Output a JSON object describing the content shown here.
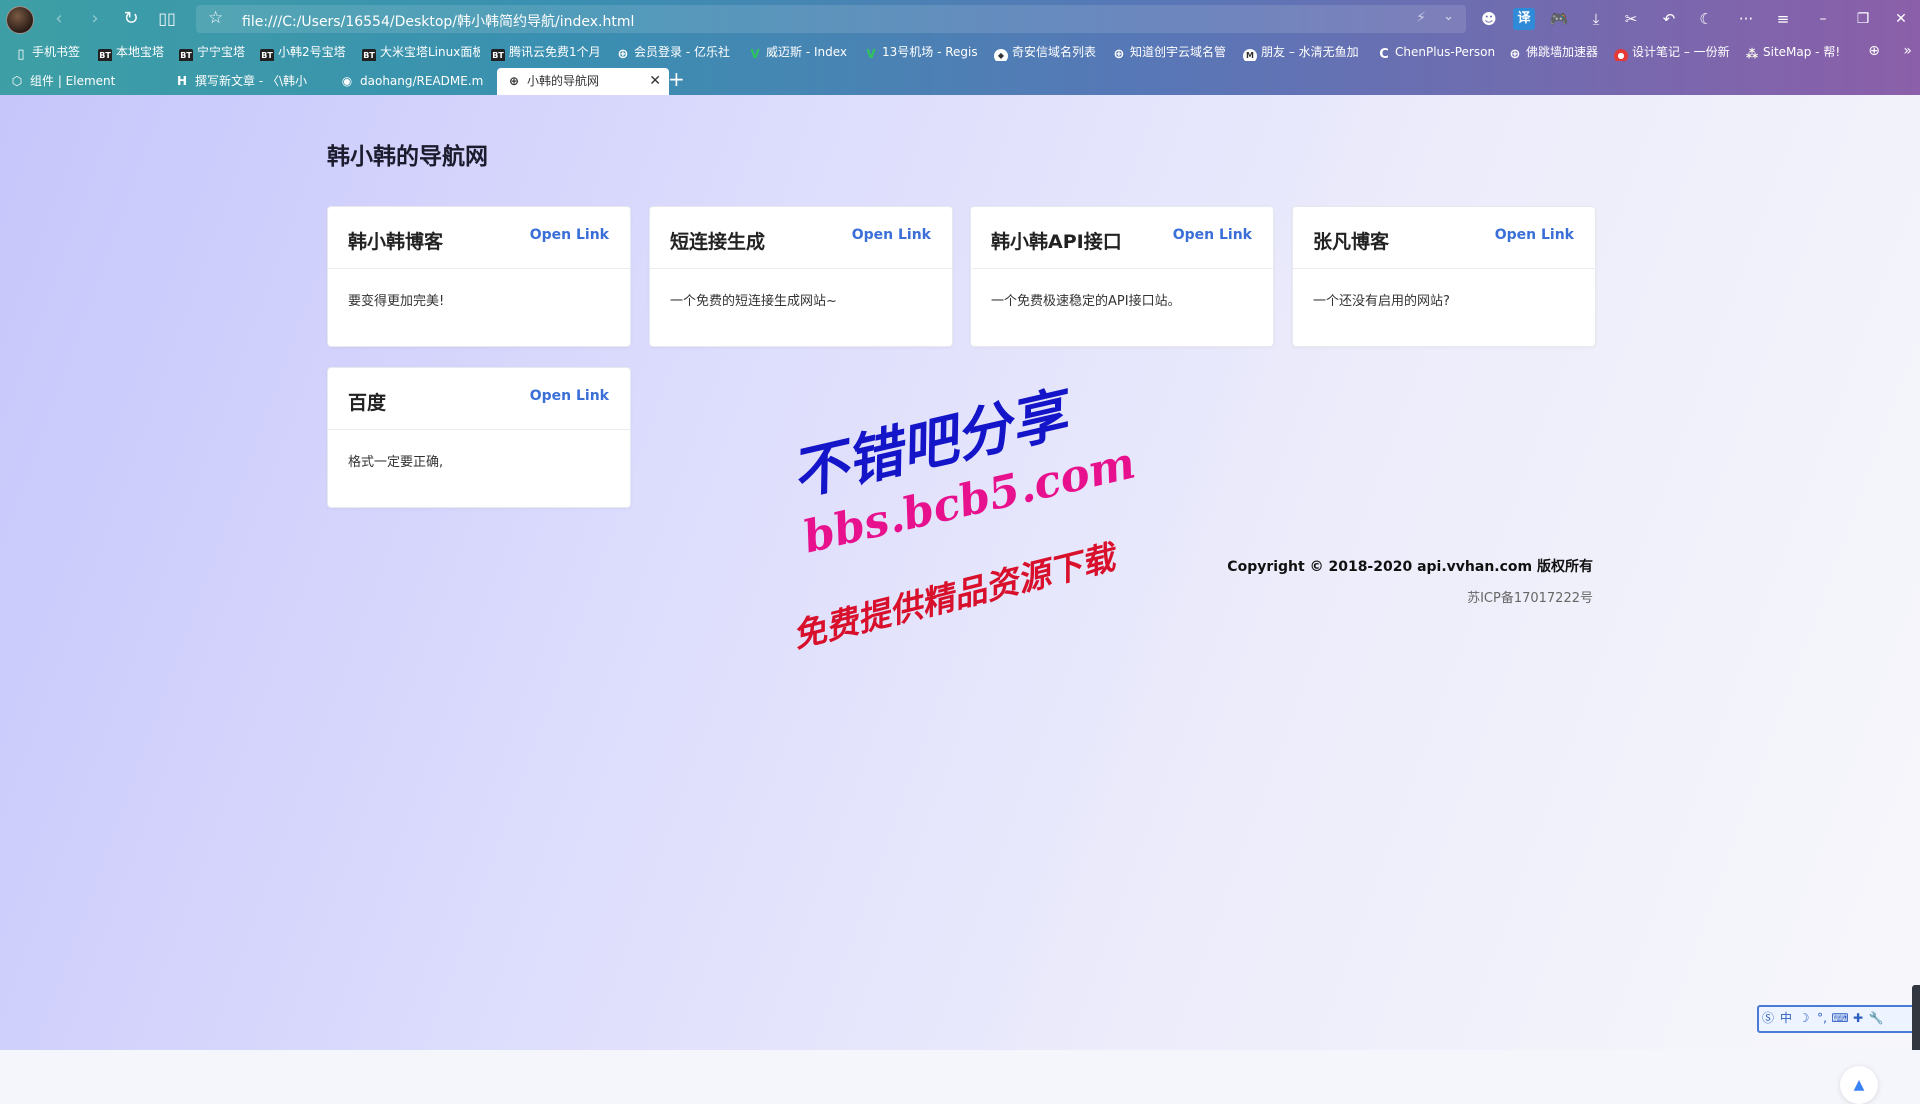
{
  "browser": {
    "url": "file:///C:/Users/16554/Desktop/韩小韩简约导航/index.html",
    "translate_icon_label": "译",
    "bookmarks": [
      {
        "label": "手机书签",
        "icon": "phone-icon"
      },
      {
        "label": "本地宝塔",
        "icon": "BT"
      },
      {
        "label": "宁宁宝塔",
        "icon": "BT"
      },
      {
        "label": "小韩2号宝塔",
        "icon": "BT"
      },
      {
        "label": "大米宝塔Linux面板",
        "icon": "BT"
      },
      {
        "label": "腾讯云免费1个月",
        "icon": "BT"
      },
      {
        "label": "会员登录 - 亿乐社",
        "icon": "globe-icon"
      },
      {
        "label": "威迈斯 - Index",
        "icon": "v-icon"
      },
      {
        "label": "13号机场 - Regis",
        "icon": "v-icon"
      },
      {
        "label": "奇安信域名列表",
        "icon": "shield-icon"
      },
      {
        "label": "知道创宇云域名管",
        "icon": "globe-icon"
      },
      {
        "label": "朋友 – 水清无鱼加",
        "icon": "m-icon"
      },
      {
        "label": "ChenPlus-Person",
        "icon": "c-icon"
      },
      {
        "label": "佛跳墙加速器",
        "icon": "globe-icon"
      },
      {
        "label": "设计笔记 – 一份新",
        "icon": "red-circle-icon"
      },
      {
        "label": "SiteMap - 帮!",
        "icon": "sitemap-icon"
      }
    ],
    "tabs": [
      {
        "label": "组件 | Element",
        "icon": "element-icon"
      },
      {
        "label": "撰写新文章 - 〈\\韩小",
        "icon": "h-icon"
      },
      {
        "label": "daohang/README.m",
        "icon": "github-icon"
      },
      {
        "label": "小韩的导航网",
        "icon": "globe-icon",
        "active": true
      }
    ]
  },
  "site": {
    "title": "韩小韩的导航网",
    "link_label": "Open Link",
    "cards": [
      {
        "title": "韩小韩博客",
        "desc": "要变得更加完美!"
      },
      {
        "title": "短连接生成",
        "desc": "一个免费的短连接生成网站~"
      },
      {
        "title": "韩小韩API接口",
        "desc": "一个免费极速稳定的API接口站。"
      },
      {
        "title": "张凡博客",
        "desc": "一个还没有启用的网站?"
      },
      {
        "title": "百度",
        "desc": "格式一定要正确,"
      }
    ],
    "copyright": "Copyright © 2018-2020 api.vvhan.com 版权所有",
    "icp": "苏ICP备17017222号"
  },
  "watermark": {
    "line1": "不错吧分享",
    "line2": "bbs.bcb5.com",
    "line3": "免费提供精品资源下载"
  },
  "ime": {
    "items": [
      "中",
      "☽",
      "°,",
      "⌨",
      "✚",
      "🔧"
    ]
  },
  "colors": {
    "link": "#3a6fd8",
    "watermark_blue": "#1414c8",
    "watermark_pink": "#e8118d",
    "watermark_red": "#d8102c"
  }
}
